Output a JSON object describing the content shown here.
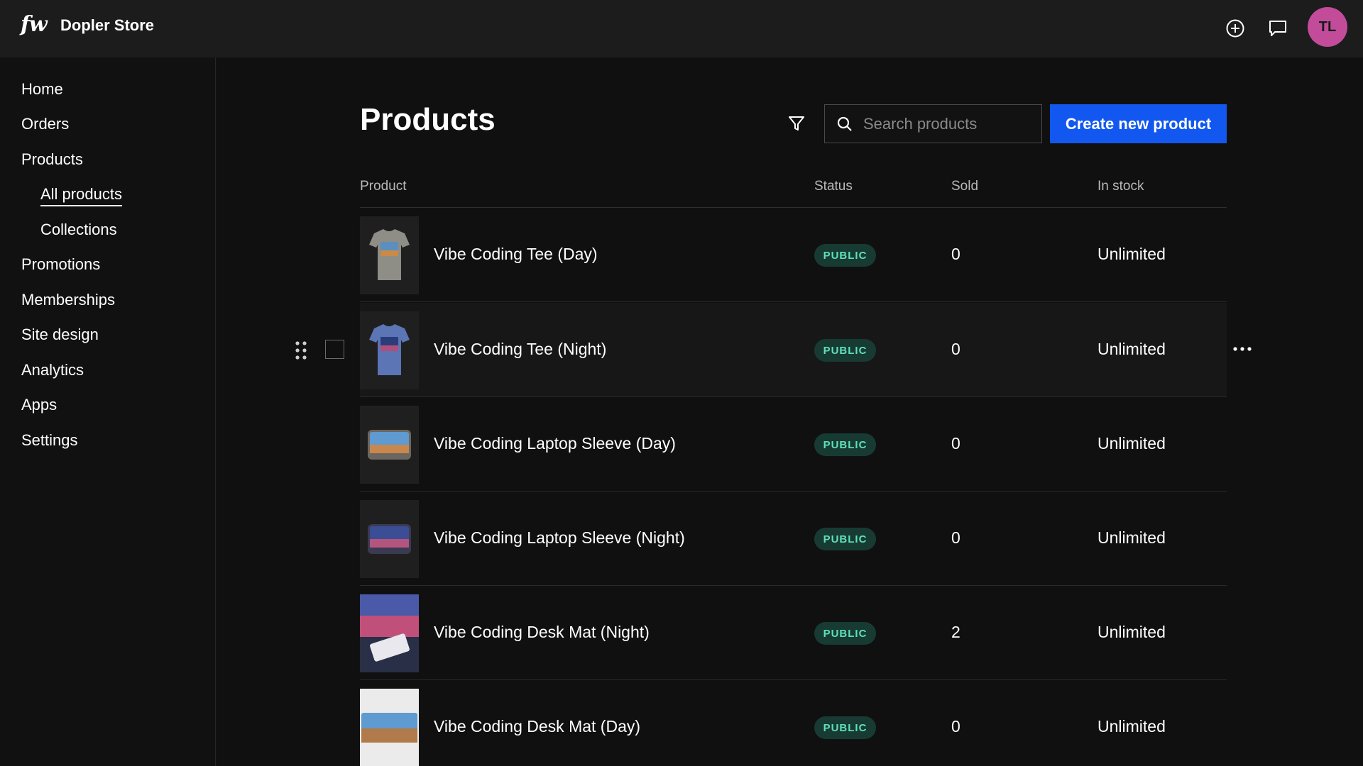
{
  "topbar": {
    "logo": "fw",
    "store_name": "Dopler Store",
    "avatar_initials": "TL",
    "avatar_color": "#c24c9a",
    "icons": [
      "plus-circle-icon",
      "chat-icon"
    ]
  },
  "sidebar": {
    "items": [
      {
        "label": "Home"
      },
      {
        "label": "Orders"
      },
      {
        "label": "Products"
      },
      {
        "label": "All products",
        "sub": true,
        "active": true
      },
      {
        "label": "Collections",
        "sub": true
      },
      {
        "label": "Promotions"
      },
      {
        "label": "Memberships"
      },
      {
        "label": "Site design"
      },
      {
        "label": "Analytics"
      },
      {
        "label": "Apps"
      },
      {
        "label": "Settings"
      }
    ]
  },
  "main": {
    "title": "Products",
    "search_placeholder": "Search products",
    "create_button": "Create new product",
    "accent_color": "#1258f0",
    "columns": {
      "product": "Product",
      "status": "Status",
      "sold": "Sold",
      "in_stock": "In stock"
    },
    "rows": [
      {
        "name": "Vibe Coding Tee (Day)",
        "status": "PUBLIC",
        "sold": "0",
        "stock": "Unlimited"
      },
      {
        "name": "Vibe Coding Tee (Night)",
        "status": "PUBLIC",
        "sold": "0",
        "stock": "Unlimited"
      },
      {
        "name": "Vibe Coding Laptop Sleeve (Day)",
        "status": "PUBLIC",
        "sold": "0",
        "stock": "Unlimited"
      },
      {
        "name": "Vibe Coding Laptop Sleeve (Night)",
        "status": "PUBLIC",
        "sold": "0",
        "stock": "Unlimited"
      },
      {
        "name": "Vibe Coding Desk Mat (Night)",
        "status": "PUBLIC",
        "sold": "2",
        "stock": "Unlimited"
      },
      {
        "name": "Vibe Coding Desk Mat (Day)",
        "status": "PUBLIC",
        "sold": "0",
        "stock": "Unlimited"
      }
    ]
  }
}
